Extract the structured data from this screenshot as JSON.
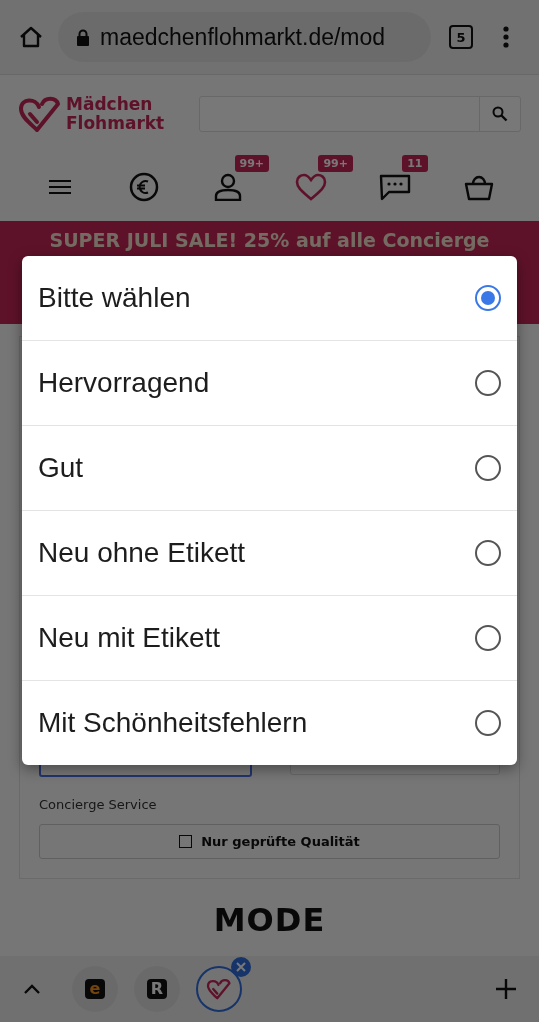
{
  "browser": {
    "url": "maedchenflohmarkt.de/mod",
    "tab_count": "5"
  },
  "site": {
    "logo_lines": [
      "Mädchen",
      "Flohmarkt"
    ],
    "nav": [
      {
        "kind": "menu"
      },
      {
        "kind": "euro"
      },
      {
        "kind": "user",
        "badge": "99+"
      },
      {
        "kind": "heart",
        "badge": "99+"
      },
      {
        "kind": "chat",
        "badge": "11"
      },
      {
        "kind": "basket"
      }
    ]
  },
  "banner": {
    "text": "SUPER JULI SALE! 25% auf alle Concierge"
  },
  "filter": {
    "label": "Concierge Service",
    "checkbox": {
      "label": "Nur geprüfte Qualität",
      "checked": false
    }
  },
  "section_title": "MODE",
  "dialog": {
    "options": [
      {
        "label": "Bitte wählen",
        "selected": true
      },
      {
        "label": "Hervorragend",
        "selected": false
      },
      {
        "label": "Gut",
        "selected": false
      },
      {
        "label": "Neu ohne Etikett",
        "selected": false
      },
      {
        "label": "Neu mit Etikett",
        "selected": false
      },
      {
        "label": "Mit Schönheitsfehlern",
        "selected": false
      }
    ]
  },
  "tab_strip": {
    "tabs": [
      {
        "kind": "letter",
        "label": "e",
        "selected": false
      },
      {
        "kind": "letter",
        "label": "R",
        "selected": false
      },
      {
        "kind": "heart",
        "selected": true
      }
    ]
  }
}
